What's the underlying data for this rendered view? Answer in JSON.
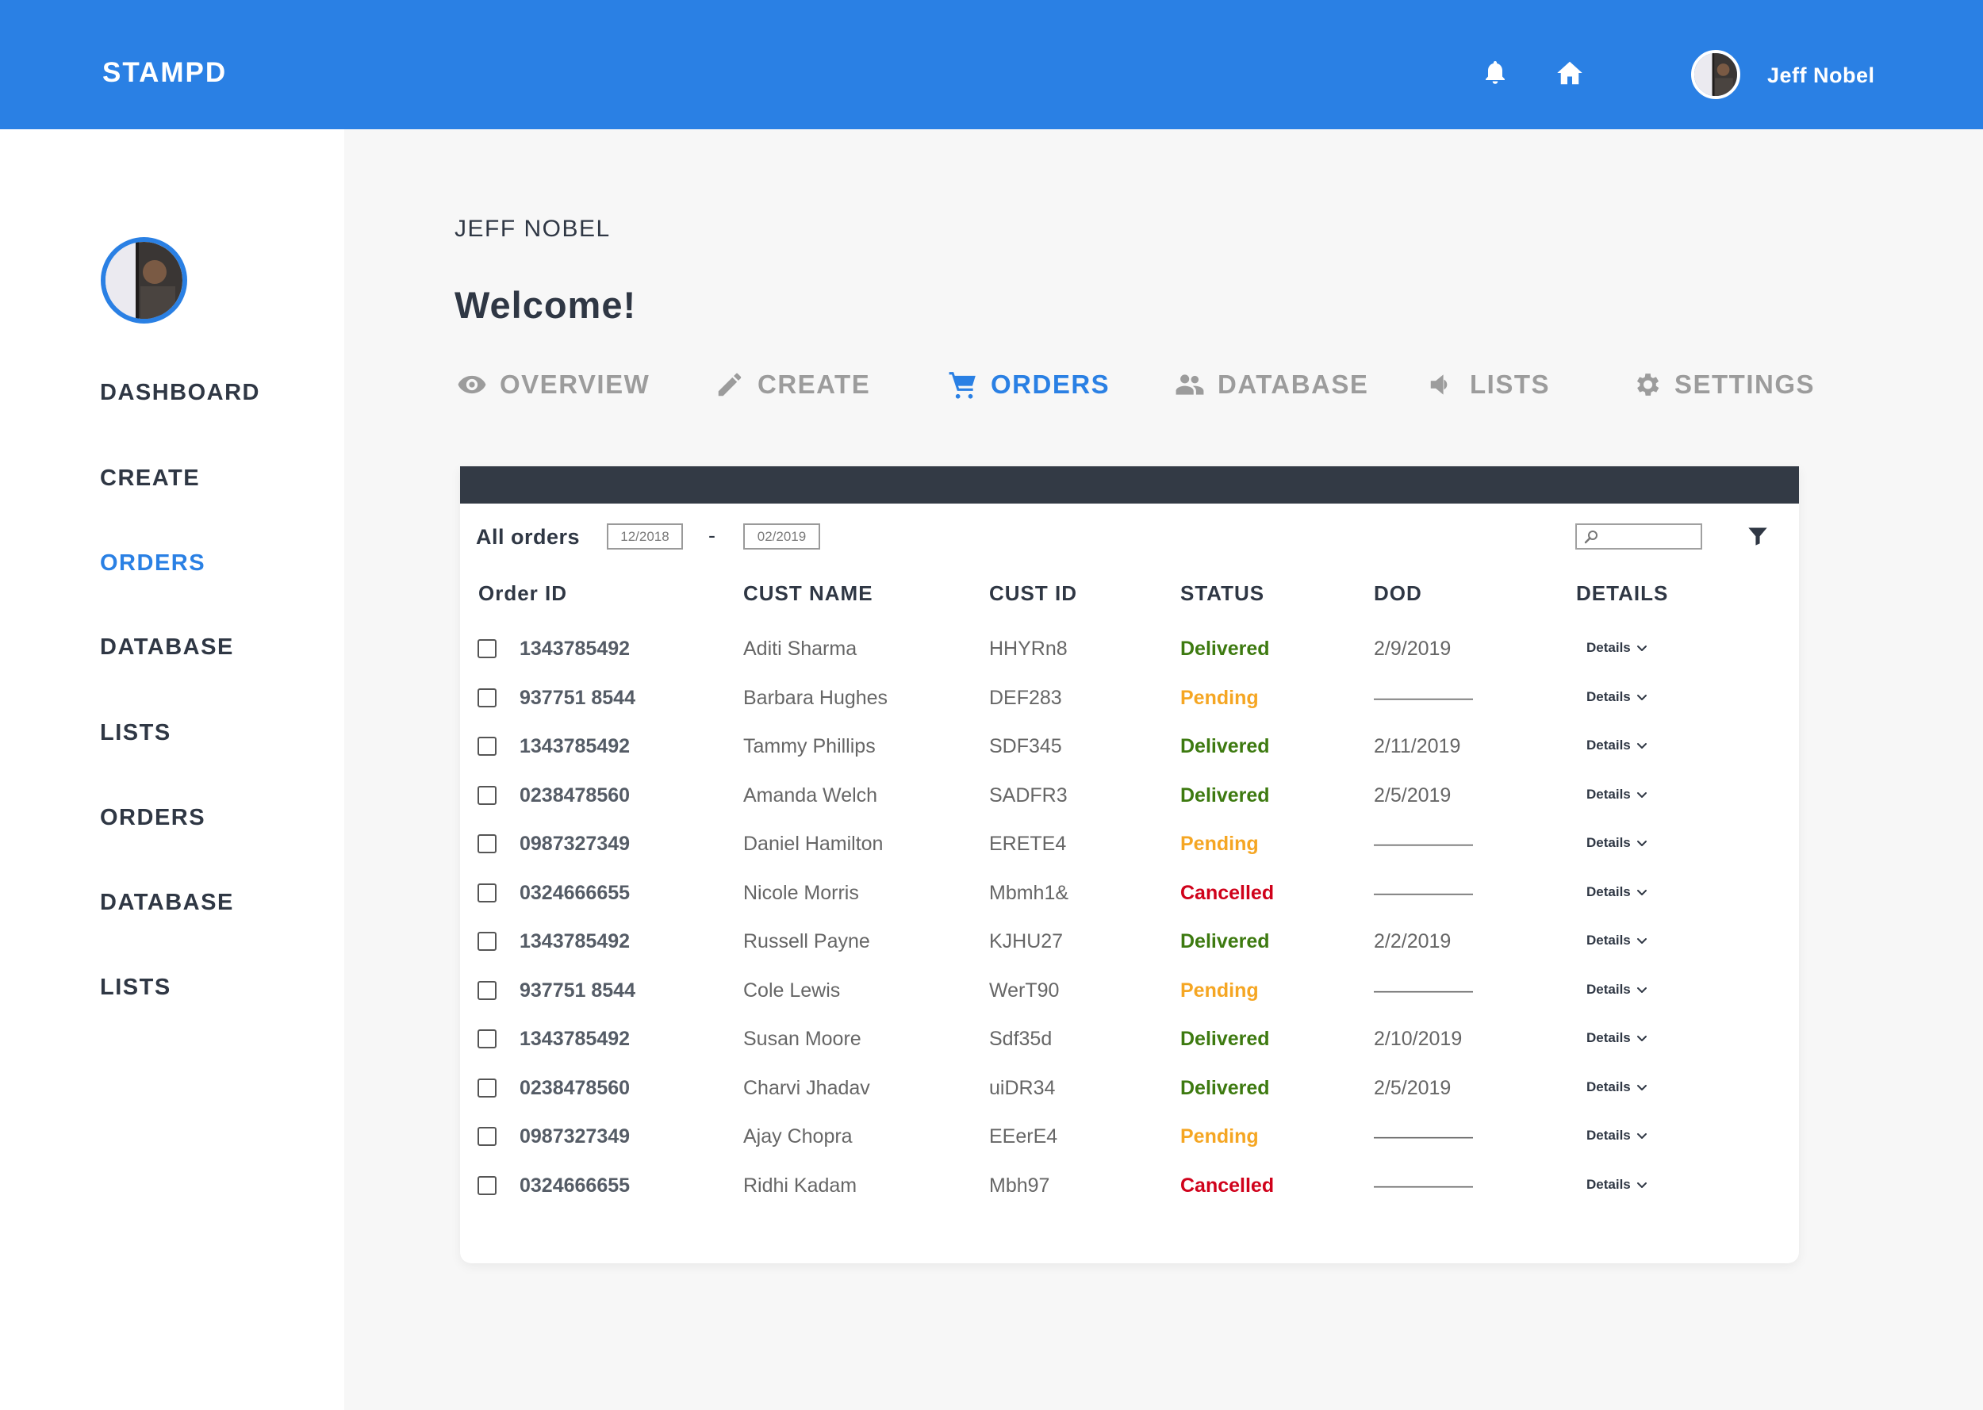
{
  "app": {
    "brand": "STAMPD"
  },
  "topbar": {
    "user_name": "Jeff Nobel"
  },
  "sidebar": {
    "items": [
      {
        "label": "DASHBOARD",
        "active": false
      },
      {
        "label": "CREATE",
        "active": false
      },
      {
        "label": "ORDERS",
        "active": true
      },
      {
        "label": "DATABASE",
        "active": false
      },
      {
        "label": "LISTS",
        "active": false
      },
      {
        "label": "ORDERS",
        "active": false
      },
      {
        "label": "DATABASE",
        "active": false
      },
      {
        "label": "LISTS",
        "active": false
      }
    ]
  },
  "main": {
    "user_name": "JEFF NOBEL",
    "welcome": "Welcome!",
    "tabs": [
      {
        "label": "OVERVIEW",
        "icon": "eye-icon",
        "active": false
      },
      {
        "label": "CREATE",
        "icon": "pencil-icon",
        "active": false
      },
      {
        "label": "ORDERS",
        "icon": "cart-icon",
        "active": true
      },
      {
        "label": "DATABASE",
        "icon": "users-icon",
        "active": false
      },
      {
        "label": "LISTS",
        "icon": "megaphone-icon",
        "active": false
      },
      {
        "label": "SETTINGS",
        "icon": "gear-icon",
        "active": false
      }
    ]
  },
  "orders": {
    "title": "All orders",
    "date_from": "12/2018",
    "date_sep": "-",
    "date_to": "02/2019",
    "columns": [
      "Order ID",
      "CUST NAME",
      "CUST ID",
      "STATUS",
      "DOD",
      "DETAILS"
    ],
    "details_label": "Details",
    "status_colors": {
      "Delivered": "#3d7a10",
      "Pending": "#f5a623",
      "Cancelled": "#d0021b"
    },
    "rows": [
      {
        "order_id": "1343785492",
        "cust_name": "Aditi Sharma",
        "cust_id": "HHYRn8",
        "status": "Delivered",
        "dod": "2/9/2019"
      },
      {
        "order_id": "937751 8544",
        "cust_name": "Barbara Hughes",
        "cust_id": "DEF283",
        "status": "Pending",
        "dod": "—————"
      },
      {
        "order_id": "1343785492",
        "cust_name": "Tammy Phillips",
        "cust_id": "SDF345",
        "status": "Delivered",
        "dod": "2/11/2019"
      },
      {
        "order_id": "0238478560",
        "cust_name": "Amanda Welch",
        "cust_id": "SADFR3",
        "status": "Delivered",
        "dod": "2/5/2019"
      },
      {
        "order_id": "0987327349",
        "cust_name": "Daniel Hamilton",
        "cust_id": "ERETE4",
        "status": "Pending",
        "dod": "—————"
      },
      {
        "order_id": "0324666655",
        "cust_name": "Nicole Morris",
        "cust_id": "Mbmh1&",
        "status": "Cancelled",
        "dod": "—————"
      },
      {
        "order_id": "1343785492",
        "cust_name": "Russell Payne",
        "cust_id": "KJHU27",
        "status": "Delivered",
        "dod": "2/2/2019"
      },
      {
        "order_id": "937751 8544",
        "cust_name": "Cole Lewis",
        "cust_id": "WerT90",
        "status": "Pending",
        "dod": "—————"
      },
      {
        "order_id": "1343785492",
        "cust_name": "Susan Moore",
        "cust_id": "Sdf35d",
        "status": "Delivered",
        "dod": "2/10/2019"
      },
      {
        "order_id": "0238478560",
        "cust_name": "Charvi Jhadav",
        "cust_id": "uiDR34",
        "status": "Delivered",
        "dod": "2/5/2019"
      },
      {
        "order_id": "0987327349",
        "cust_name": "Ajay Chopra",
        "cust_id": "EEerE4",
        "status": "Pending",
        "dod": "—————"
      },
      {
        "order_id": "0324666655",
        "cust_name": "Ridhi Kadam",
        "cust_id": "Mbh97",
        "status": "Cancelled",
        "dod": "—————"
      }
    ]
  }
}
